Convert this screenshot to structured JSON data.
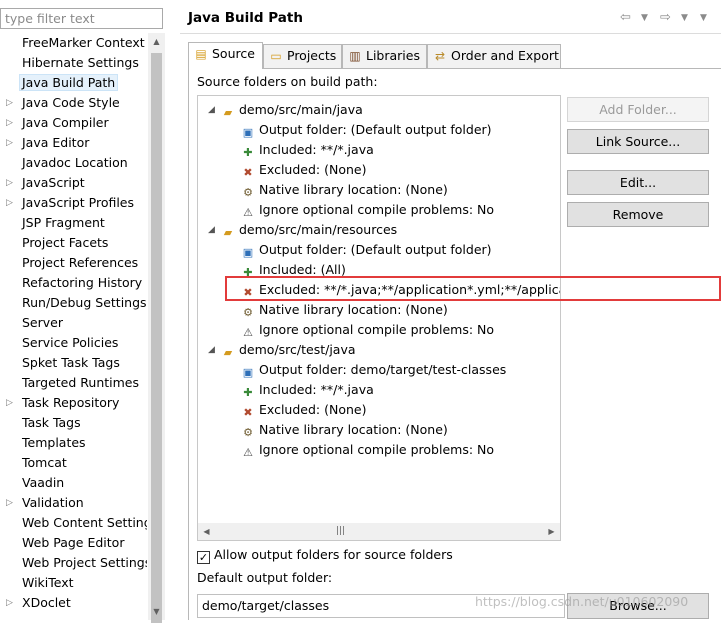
{
  "filter": {
    "placeholder": "type filter text"
  },
  "nav": {
    "items": [
      {
        "label": "FreeMarker Context",
        "expandable": false
      },
      {
        "label": "Hibernate Settings",
        "expandable": false
      },
      {
        "label": "Java Build Path",
        "expandable": false,
        "selected": true
      },
      {
        "label": "Java Code Style",
        "expandable": true
      },
      {
        "label": "Java Compiler",
        "expandable": true
      },
      {
        "label": "Java Editor",
        "expandable": true
      },
      {
        "label": "Javadoc Location",
        "expandable": false
      },
      {
        "label": "JavaScript",
        "expandable": true
      },
      {
        "label": "JavaScript Profiles",
        "expandable": true
      },
      {
        "label": "JSP Fragment",
        "expandable": false
      },
      {
        "label": "Project Facets",
        "expandable": false
      },
      {
        "label": "Project References",
        "expandable": false
      },
      {
        "label": "Refactoring History",
        "expandable": false
      },
      {
        "label": "Run/Debug Settings",
        "expandable": false
      },
      {
        "label": "Server",
        "expandable": false
      },
      {
        "label": "Service Policies",
        "expandable": false
      },
      {
        "label": "Spket Task Tags",
        "expandable": false
      },
      {
        "label": "Targeted Runtimes",
        "expandable": false
      },
      {
        "label": "Task Repository",
        "expandable": true
      },
      {
        "label": "Task Tags",
        "expandable": false
      },
      {
        "label": "Templates",
        "expandable": false
      },
      {
        "label": "Tomcat",
        "expandable": false
      },
      {
        "label": "Vaadin",
        "expandable": false
      },
      {
        "label": "Validation",
        "expandable": true
      },
      {
        "label": "Web Content Settings",
        "expandable": false
      },
      {
        "label": "Web Page Editor",
        "expandable": false
      },
      {
        "label": "Web Project Settings",
        "expandable": false
      },
      {
        "label": "WikiText",
        "expandable": false
      },
      {
        "label": "XDoclet",
        "expandable": true
      }
    ]
  },
  "header": {
    "title": "Java Build Path"
  },
  "tabs": [
    {
      "label": "Source",
      "icon": "source-folder-icon",
      "active": true
    },
    {
      "label": "Projects",
      "icon": "projects-icon",
      "active": false
    },
    {
      "label": "Libraries",
      "icon": "libraries-icon",
      "active": false
    },
    {
      "label": "Order and Export",
      "icon": "order-export-icon",
      "active": false
    }
  ],
  "source": {
    "section_label": "Source folders on build path:",
    "tree": [
      {
        "level": 0,
        "kind": "folder",
        "text": "demo/src/main/java"
      },
      {
        "level": 1,
        "kind": "out",
        "text": "Output folder: (Default output folder)"
      },
      {
        "level": 1,
        "kind": "inc",
        "text": "Included: **/*.java"
      },
      {
        "level": 1,
        "kind": "exc",
        "text": "Excluded: (None)"
      },
      {
        "level": 1,
        "kind": "nat",
        "text": "Native library location: (None)"
      },
      {
        "level": 1,
        "kind": "ign",
        "text": "Ignore optional compile problems: No"
      },
      {
        "level": 0,
        "kind": "folder",
        "text": "demo/src/main/resources"
      },
      {
        "level": 1,
        "kind": "out",
        "text": "Output folder: (Default output folder)"
      },
      {
        "level": 1,
        "kind": "inc",
        "text": "Included: (All)"
      },
      {
        "level": 1,
        "kind": "exc",
        "text": "Excluded: **/*.java;**/application*.yml;**/application*.yaml;**/application*.prope",
        "highlighted": true
      },
      {
        "level": 1,
        "kind": "nat",
        "text": "Native library location: (None)"
      },
      {
        "level": 1,
        "kind": "ign",
        "text": "Ignore optional compile problems: No"
      },
      {
        "level": 0,
        "kind": "folder",
        "text": "demo/src/test/java"
      },
      {
        "level": 1,
        "kind": "out",
        "text": "Output folder: demo/target/test-classes"
      },
      {
        "level": 1,
        "kind": "inc",
        "text": "Included: **/*.java"
      },
      {
        "level": 1,
        "kind": "exc",
        "text": "Excluded: (None)"
      },
      {
        "level": 1,
        "kind": "nat",
        "text": "Native library location: (None)"
      },
      {
        "level": 1,
        "kind": "ign",
        "text": "Ignore optional compile problems: No"
      }
    ],
    "buttons": {
      "add_folder": "Add Folder...",
      "link_source": "Link Source...",
      "edit": "Edit...",
      "remove": "Remove"
    },
    "allow_output_folders": {
      "label": "Allow output folders for source folders",
      "checked": true
    },
    "default_output_label": "Default output folder:",
    "default_output_value": "demo/target/classes",
    "browse_label": "Browse..."
  },
  "watermark": "https://blog.csdn.net/u010602090"
}
